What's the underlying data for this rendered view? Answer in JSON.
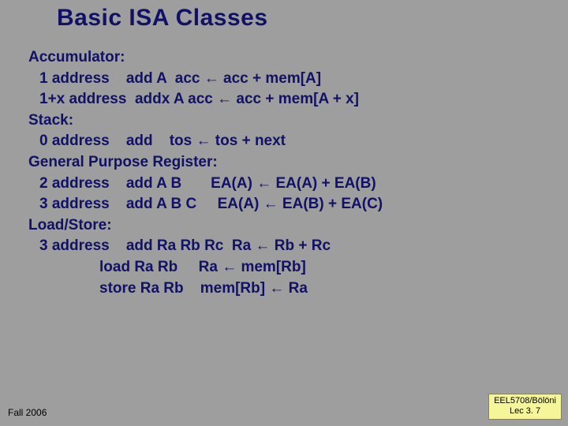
{
  "title": "Basic ISA Classes",
  "sections": {
    "accumulator": {
      "heading": "Accumulator:",
      "rows": [
        "1 address    add A  acc ← acc + mem[A]",
        "1+x address  addx A acc ← acc + mem[A + x]"
      ]
    },
    "stack": {
      "heading": "Stack:",
      "rows": [
        "0 address    add    tos ← tos + next"
      ]
    },
    "gpr": {
      "heading": "General Purpose Register:",
      "rows": [
        "2 address    add A B       EA(A) ← EA(A) + EA(B)",
        "3 address    add A B C     EA(A) ← EA(B) + EA(C)"
      ]
    },
    "loadstore": {
      "heading": "Load/Store:",
      "rows": [
        "3 address    add Ra Rb Rc  Ra ← Rb + Rc",
        "load Ra Rb     Ra ← mem[Rb]",
        "store Ra Rb    mem[Rb] ← Ra"
      ]
    }
  },
  "footer": {
    "left": "Fall 2006",
    "right_line1": "EEL5708/Bölöni",
    "right_line2": "Lec 3. 7"
  }
}
